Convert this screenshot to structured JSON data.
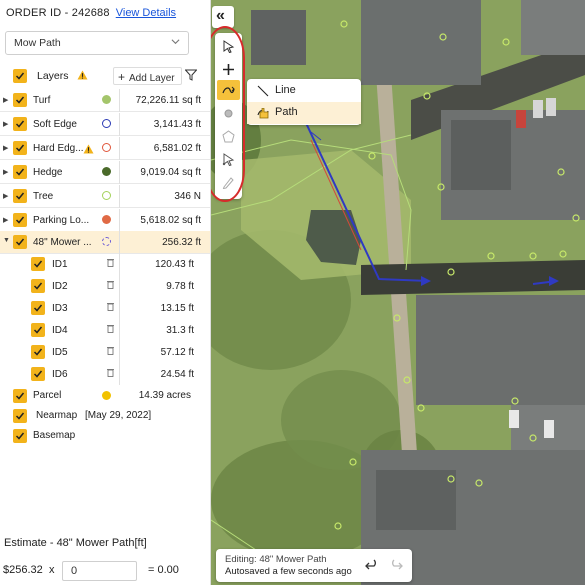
{
  "order": {
    "label": "ORDER ID - 242688",
    "view_details": "View Details"
  },
  "view_select": {
    "value": "Mow Path"
  },
  "layers_header": {
    "title": "Layers",
    "add_layer": "Add Layer"
  },
  "layers": [
    {
      "name": "Turf",
      "value": "72,226.11 sq ft",
      "color": "#a4c56b",
      "dot": "filled"
    },
    {
      "name": "Soft Edge",
      "value": "3,141.43 ft",
      "color": "#2d3bb5",
      "dot": "ring"
    },
    {
      "name": "Hard Edg...",
      "value": "6,581.02 ft",
      "color": "#e0573c",
      "dot": "ring"
    },
    {
      "name": "Hedge",
      "value": "9,019.04 sq ft",
      "color": "#4a6a2a",
      "dot": "filled"
    },
    {
      "name": "Tree",
      "value": "346 N",
      "color": "#a4d25a",
      "dot": "ring"
    },
    {
      "name": "Parking Lo...",
      "value": "5,618.02 sq ft",
      "color": "#e06a45",
      "dot": "filled"
    },
    {
      "name": "48\" Mower ...",
      "value": "256.32 ft",
      "color": "#6b5bd6",
      "dot": "dashed"
    }
  ],
  "sublayers": [
    {
      "name": "ID1",
      "value": "120.43 ft"
    },
    {
      "name": "ID2",
      "value": "9.78 ft"
    },
    {
      "name": "ID3",
      "value": "13.15 ft"
    },
    {
      "name": "ID4",
      "value": "31.3 ft"
    },
    {
      "name": "ID5",
      "value": "57.12 ft"
    },
    {
      "name": "ID6",
      "value": "24.54 ft"
    }
  ],
  "parcel": {
    "name": "Parcel",
    "value": "14.39 acres",
    "color": "#f2c200"
  },
  "nearmap": {
    "name": "Nearmap",
    "date": "[May 29, 2022]"
  },
  "basemap": {
    "name": "Basemap"
  },
  "estimate": {
    "title": "Estimate - 48\" Mower Path[ft]",
    "price": "$256.32",
    "times": "x",
    "quantity": "0",
    "total": "= 0.00"
  },
  "tools": {
    "collapse": "«",
    "submenu": {
      "line": "Line",
      "path": "Path"
    }
  },
  "status": {
    "editing": "Editing: 48\" Mower Path",
    "autosave": "Autosaved a few seconds ago"
  },
  "colors": {
    "accent": "#f5c13b",
    "highlight": "#d62b2b",
    "path": "#2f3ac2",
    "link": "#1a56db"
  }
}
